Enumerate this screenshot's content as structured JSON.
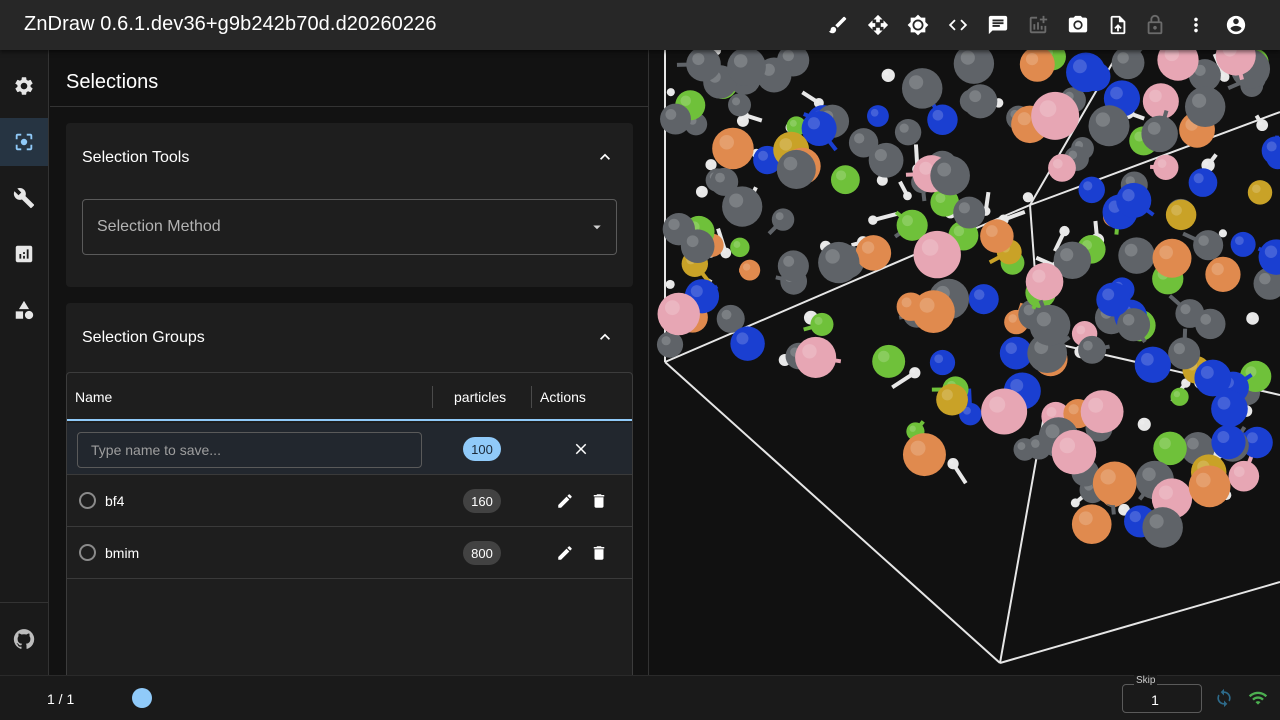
{
  "app": {
    "title": "ZnDraw 0.6.1.dev36+g9b242b70d.d20260226"
  },
  "toolbar": {
    "icons": [
      "brush-icon",
      "move-icon",
      "brightness-icon",
      "code-icon",
      "chat-icon",
      "add-chart-icon",
      "camera-icon",
      "upload-file-icon",
      "lock-icon",
      "more-vert-icon",
      "account-icon"
    ]
  },
  "sidebar": {
    "items": [
      "settings-icon",
      "selection-icon",
      "wrench-icon",
      "analytics-icon",
      "shapes-icon"
    ],
    "active": "selection-icon",
    "footer": "github-icon"
  },
  "panel": {
    "title": "Selections",
    "tools_card": {
      "title": "Selection Tools",
      "select_label": "Selection Method"
    },
    "groups_card": {
      "title": "Selection Groups",
      "columns": [
        "Name",
        "particles",
        "Actions"
      ],
      "new_row": {
        "placeholder": "Type name to save...",
        "count": "100"
      },
      "rows": [
        {
          "name": "bf4",
          "count": "160"
        },
        {
          "name": "bmim",
          "count": "800"
        }
      ]
    }
  },
  "bottom": {
    "frame": "1 / 1",
    "skip_label": "Skip",
    "skip_value": "1"
  },
  "colors": {
    "accent": "#90caf9",
    "connection": "#4caf50",
    "atom_colors": [
      "#5f6368",
      "#e8e8e8",
      "#1a3fd1",
      "#6fc13a",
      "#e08a4e",
      "#e7a6b4",
      "#c9a227"
    ]
  }
}
